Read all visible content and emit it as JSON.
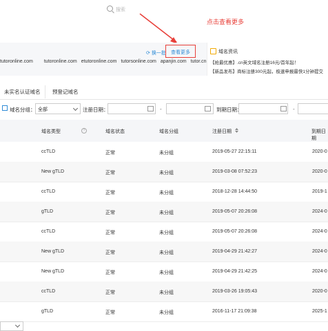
{
  "search": {
    "placeholder": "搜索"
  },
  "annotation": {
    "text": "点击查看更多"
  },
  "domain_strip": {
    "names": [
      "tutoronline.com",
      "tutoronline.com",
      "etutoronline.com",
      "tutorsonline.com",
      "apanjin.com",
      "tutor.cn"
    ],
    "swap_label": "换一批",
    "view_more_label": "查看更多"
  },
  "news": {
    "title": "域名资讯",
    "lines": [
      "【抢最优惠】.cn英文域名注册16元/首年起！",
      "【新品发布】商标注册300元起，极速申报最快1分钟提交"
    ]
  },
  "tabs": [
    {
      "label": "未实名认证域名"
    },
    {
      "label": "预登记域名"
    }
  ],
  "filters": {
    "group_label": "域名分组：",
    "group_value": "全部",
    "reg_date_label": "注册日期：",
    "exp_date_label": "到期日期：",
    "range_sep": "-"
  },
  "table": {
    "columns": [
      "域名类型",
      "域名状态",
      "域名分组",
      "注册日期",
      "到期日期"
    ],
    "rows": [
      {
        "type": "ccTLD",
        "status": "正常",
        "group": "未分组",
        "reg": "2019-05-27 22:15:11",
        "exp": "2020-0"
      },
      {
        "type": "New gTLD",
        "status": "正常",
        "group": "未分组",
        "reg": "2019-03-08 07:52:23",
        "exp": "2020-0"
      },
      {
        "type": "ccTLD",
        "status": "正常",
        "group": "未分组",
        "reg": "2018-12-28 14:44:50",
        "exp": "2019-1"
      },
      {
        "type": "gTLD",
        "status": "正常",
        "group": "未分组",
        "reg": "2019-05-07 20:26:08",
        "exp": "2024-0"
      },
      {
        "type": "ccTLD",
        "status": "正常",
        "group": "未分组",
        "reg": "2019-05-07 20:26:08",
        "exp": "2024-0"
      },
      {
        "type": "New gTLD",
        "status": "正常",
        "group": "未分组",
        "reg": "2019-04-29 21:42:27",
        "exp": "2024-0"
      },
      {
        "type": "New gTLD",
        "status": "正常",
        "group": "未分组",
        "reg": "2019-04-29 21:42:25",
        "exp": "2024-0"
      },
      {
        "type": "ccTLD",
        "status": "正常",
        "group": "未分组",
        "reg": "2019-03-26 19:05:43",
        "exp": "2020-0"
      },
      {
        "type": "gTLD",
        "status": "正常",
        "group": "未分组",
        "reg": "2016-11-17 21:09:38",
        "exp": "2025-1"
      }
    ]
  },
  "colors": {
    "accent": "#2e8bd6",
    "annotation_red": "#e8403a",
    "header_bg": "#f5f6f8"
  }
}
